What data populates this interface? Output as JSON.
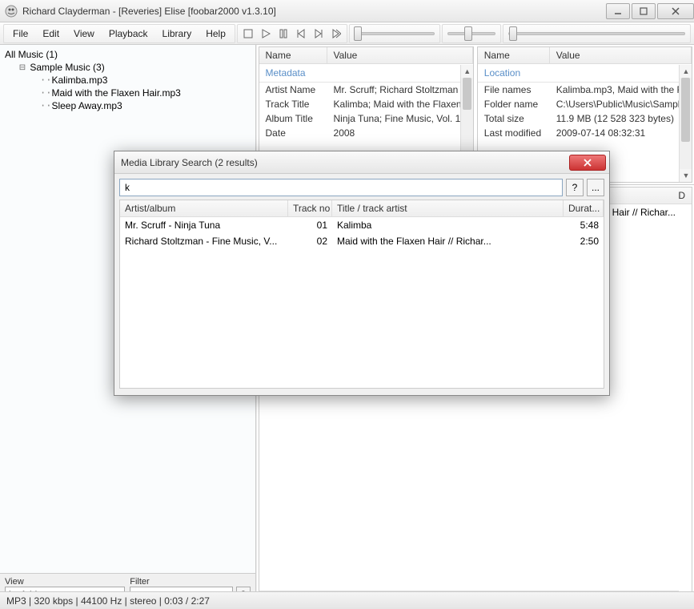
{
  "window": {
    "title": "Richard Clayderman - [Reveries] Elise   [foobar2000 v1.3.10]"
  },
  "menu": {
    "items": [
      "File",
      "Edit",
      "View",
      "Playback",
      "Library",
      "Help"
    ]
  },
  "tree": {
    "root": "All Music (1)",
    "group": "Sample Music (3)",
    "files": [
      "Kalimba.mp3",
      "Maid with the Flaxen Hair.mp3",
      "Sleep Away.mp3"
    ]
  },
  "leftControls": {
    "viewLabel": "View",
    "viewValue": "by folder structure",
    "filterLabel": "Filter",
    "filterValue": "",
    "help": "?"
  },
  "metadata": {
    "colName": "Name",
    "colValue": "Value",
    "section": "Metadata",
    "rows": [
      {
        "name": "Artist Name",
        "value": "Mr. Scruff; Richard Stoltzman"
      },
      {
        "name": "Track Title",
        "value": "Kalimba; Maid with the Flaxen"
      },
      {
        "name": "Album Title",
        "value": "Ninja Tuna; Fine Music, Vol. 1"
      },
      {
        "name": "Date",
        "value": "2008"
      }
    ]
  },
  "location": {
    "colName": "Name",
    "colValue": "Value",
    "section": "Location",
    "rows": [
      {
        "name": "File names",
        "value": "Kalimba.mp3, Maid with the Fla"
      },
      {
        "name": "Folder name",
        "value": "C:\\Users\\Public\\Music\\Sample"
      },
      {
        "name": "Total size",
        "value": "11.9 MB (12 528 323 bytes)"
      },
      {
        "name": "Last modified",
        "value": "2009-07-14 08:32:31"
      }
    ]
  },
  "playlist": {
    "colD": "D",
    "row0": "Hair // Richar..."
  },
  "dialog": {
    "title": "Media Library Search (2 results)",
    "searchValue": "k",
    "help": "?",
    "more": "...",
    "cols": [
      "Artist/album",
      "Track no",
      "Title / track artist",
      "Durat..."
    ],
    "rows": [
      {
        "artist": "Mr. Scruff - Ninja Tuna",
        "trackno": "01",
        "title": "Kalimba",
        "dur": "5:48"
      },
      {
        "artist": "Richard Stoltzman - Fine Music, V...",
        "trackno": "02",
        "title": "Maid with the Flaxen Hair // Richar...",
        "dur": "2:50"
      }
    ]
  },
  "status": {
    "text": "MP3 | 320 kbps | 44100 Hz | stereo | 0:03 / 2:27"
  }
}
